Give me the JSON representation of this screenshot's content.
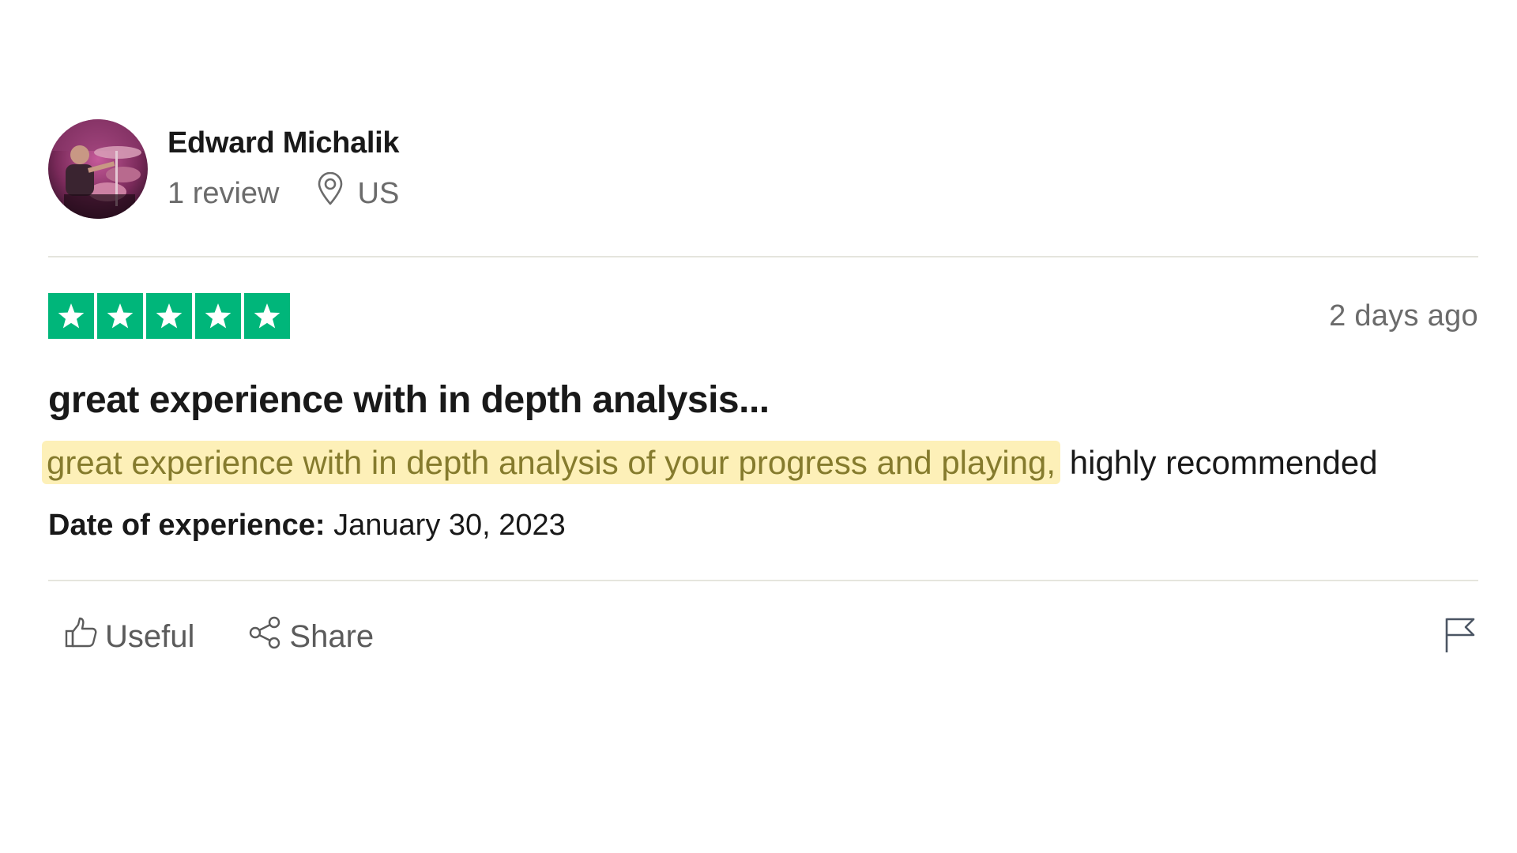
{
  "reviewer": {
    "name": "Edward Michalik",
    "review_count": "1 review",
    "location": "US",
    "avatar_icon": "reviewer-avatar-photo"
  },
  "review": {
    "rating": 5,
    "rating_max": 5,
    "star_color": "#00b67a",
    "posted": "2 days ago",
    "title": "great experience with in depth analysis...",
    "body_highlighted": "great experience with in depth analysis of your progress and playing,",
    "body_rest": " highly recommended",
    "highlight_color": "#fdf0b8",
    "experience_label": "Date of experience:",
    "experience_date": "January 30, 2023"
  },
  "actions": {
    "useful_label": "Useful",
    "useful_icon": "thumbs-up-icon",
    "share_label": "Share",
    "share_icon": "share-icon",
    "report_icon": "flag-icon"
  }
}
